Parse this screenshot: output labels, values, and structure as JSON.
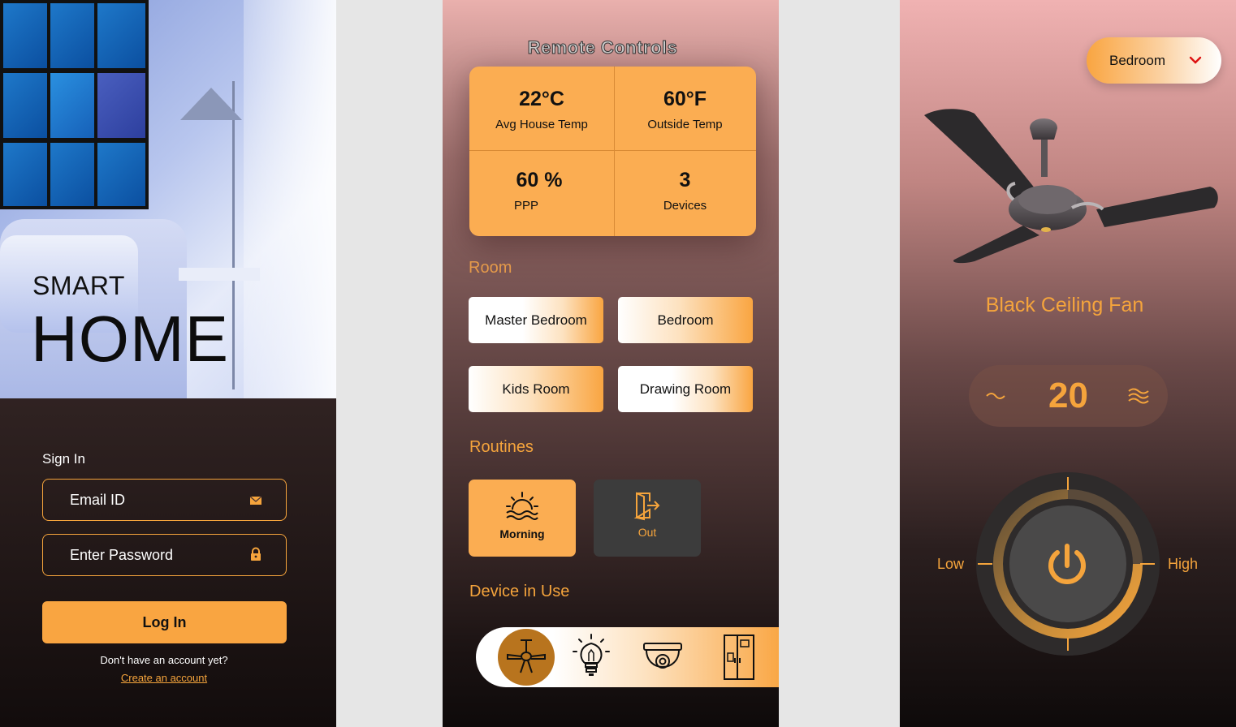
{
  "signin": {
    "brand_small": "SMART",
    "brand_large": "HOME",
    "title": "Sign In",
    "email_placeholder": "Email ID",
    "password_placeholder": "Enter Password",
    "login_label": "Log In",
    "no_account": "Don't have an account yet?",
    "create_account": "Create an account"
  },
  "remote": {
    "title": "Remote Controls",
    "stats": [
      {
        "value": "22°C",
        "label": "Avg House Temp"
      },
      {
        "value": "60°F",
        "label": "Outside Temp"
      },
      {
        "value": "60 %",
        "label": "PPP"
      },
      {
        "value": "3",
        "label": "Devices"
      }
    ],
    "room_heading": "Room",
    "rooms": [
      "Master Bedroom",
      "Bedroom",
      "Kids Room",
      "Drawing Room"
    ],
    "routines_heading": "Routines",
    "routines": [
      {
        "label": "Morning",
        "icon": "sunrise-icon",
        "active": true
      },
      {
        "label": "Out",
        "icon": "exit-door-icon",
        "active": false
      }
    ],
    "devices_heading": "Device in Use",
    "devices": [
      {
        "icon": "ceiling-fan-icon",
        "active": true
      },
      {
        "icon": "light-bulb-icon",
        "active": false
      },
      {
        "icon": "security-camera-icon",
        "active": false
      },
      {
        "icon": "refrigerator-icon",
        "active": false
      }
    ]
  },
  "fan": {
    "room": "Bedroom",
    "device_name": "Black Ceiling Fan",
    "speed": "20",
    "low_label": "Low",
    "high_label": "High"
  },
  "colors": {
    "accent": "#f9a541",
    "dark_panel": "#3a3a3a"
  }
}
